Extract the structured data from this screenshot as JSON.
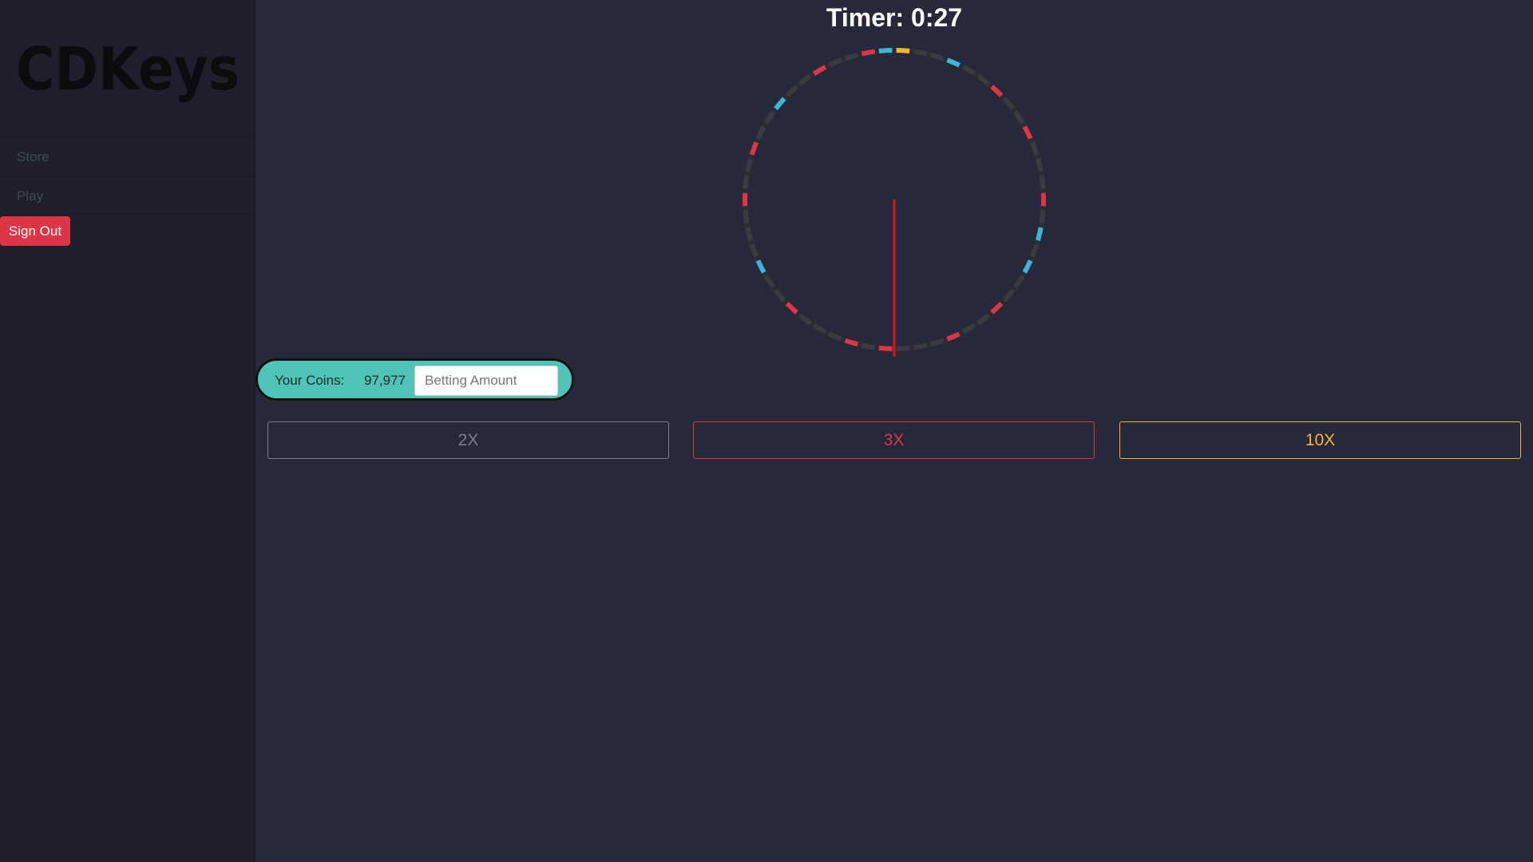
{
  "sidebar": {
    "logo_text": "CDKeys",
    "nav": [
      {
        "label": "Store"
      },
      {
        "label": "Play"
      }
    ],
    "signout_label": "Sign Out"
  },
  "game": {
    "timer_text": "Timer: 0:27",
    "wheel": {
      "segment_count": 54,
      "segment_colors": {
        "gray": "#3a3a40",
        "red": "#dc3545",
        "blue": "#3bb6d8",
        "gold": "#f4b531"
      },
      "pointer_color": "#d9141f",
      "segments": [
        "gold",
        "gray",
        "gray",
        "blue",
        "gray",
        "gray",
        "red",
        "gray",
        "gray",
        "red",
        "gray",
        "gray",
        "gray",
        "red",
        "gray",
        "blue",
        "gray",
        "blue",
        "gray",
        "gray",
        "red",
        "gray",
        "gray",
        "red",
        "gray",
        "gray",
        "gray",
        "red",
        "gray",
        "red",
        "gray",
        "gray",
        "gray",
        "red",
        "gray",
        "gray",
        "blue",
        "gray",
        "gray",
        "gray",
        "red",
        "gray",
        "gray",
        "red",
        "gray",
        "gray",
        "blue",
        "gray",
        "gray",
        "red",
        "gray",
        "gray",
        "red",
        "blue"
      ]
    },
    "coins": {
      "label": "Your Coins:",
      "value": "97,977",
      "bet_placeholder": "Betting Amount"
    },
    "multipliers": [
      {
        "label": "2X"
      },
      {
        "label": "3X"
      },
      {
        "label": "10X"
      }
    ]
  }
}
